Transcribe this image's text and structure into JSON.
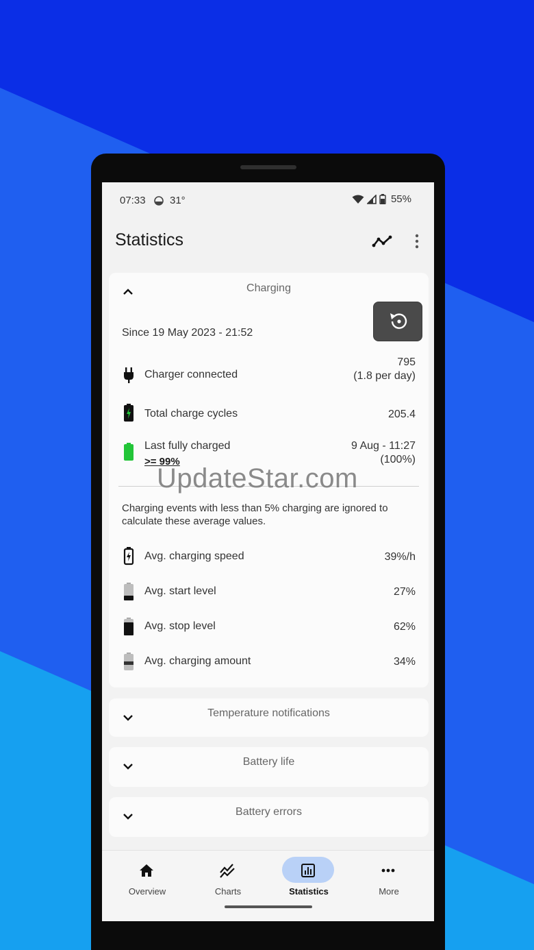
{
  "status_bar": {
    "time": "07:33",
    "temperature": "31°",
    "battery": "55%"
  },
  "app_bar": {
    "title": "Statistics"
  },
  "charging_card": {
    "title": "Charging",
    "since": "Since 19 May 2023 - 21:52",
    "rows": [
      {
        "label": "Charger connected",
        "value": "795",
        "value2": "(1.8 per day)"
      },
      {
        "label": "Total charge cycles",
        "value": "205.4"
      },
      {
        "label": "Last fully charged",
        "sublabel": ">= 99%",
        "value": "9 Aug - 11:27",
        "value2": "(100%)"
      }
    ],
    "note": "Charging events with less than 5% charging are ignored to calculate these average values.",
    "avg_rows": [
      {
        "label": "Avg. charging speed",
        "value": "39%/h"
      },
      {
        "label": "Avg. start level",
        "value": "27%"
      },
      {
        "label": "Avg. stop level",
        "value": "62%"
      },
      {
        "label": "Avg. charging amount",
        "value": "34%"
      }
    ]
  },
  "collapsed_cards": [
    {
      "title": "Temperature notifications"
    },
    {
      "title": "Battery life"
    },
    {
      "title": "Battery errors"
    }
  ],
  "watermark": "UpdateStar.com",
  "nav": [
    {
      "label": "Overview",
      "icon": "home-icon"
    },
    {
      "label": "Charts",
      "icon": "charts-icon"
    },
    {
      "label": "Statistics",
      "icon": "statistics-icon",
      "active": true
    },
    {
      "label": "More",
      "icon": "more-horiz-icon"
    }
  ],
  "colors": {
    "accent_pill": "#b9d1f7",
    "battery_green": "#22c538",
    "background_blue": "#0d2fe0"
  }
}
